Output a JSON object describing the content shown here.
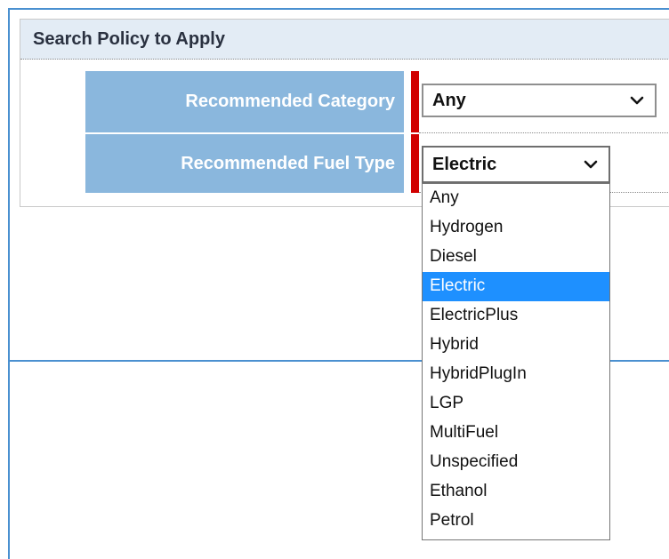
{
  "panel": {
    "title": "Search Policy to Apply"
  },
  "fields": {
    "category": {
      "label": "Recommended Category",
      "value": "Any"
    },
    "fuel_type": {
      "label": "Recommended Fuel Type",
      "value": "Electric"
    }
  },
  "fuel_dropdown": {
    "options": [
      "Any",
      "Hydrogen",
      "Diesel",
      "Electric",
      "ElectricPlus",
      "Hybrid",
      "HybridPlugIn",
      "LGP",
      "MultiFuel",
      "Unspecified",
      "Ethanol",
      "Petrol"
    ],
    "highlighted": "Electric"
  },
  "icons": {
    "select_arrow": "chevron-down-icon"
  },
  "colors": {
    "frame_border": "#4a90d0",
    "header_bg": "#e3ecf5",
    "label_bg": "#8ab7dd",
    "required_marker": "#d10000",
    "option_highlight": "#1e90ff"
  }
}
